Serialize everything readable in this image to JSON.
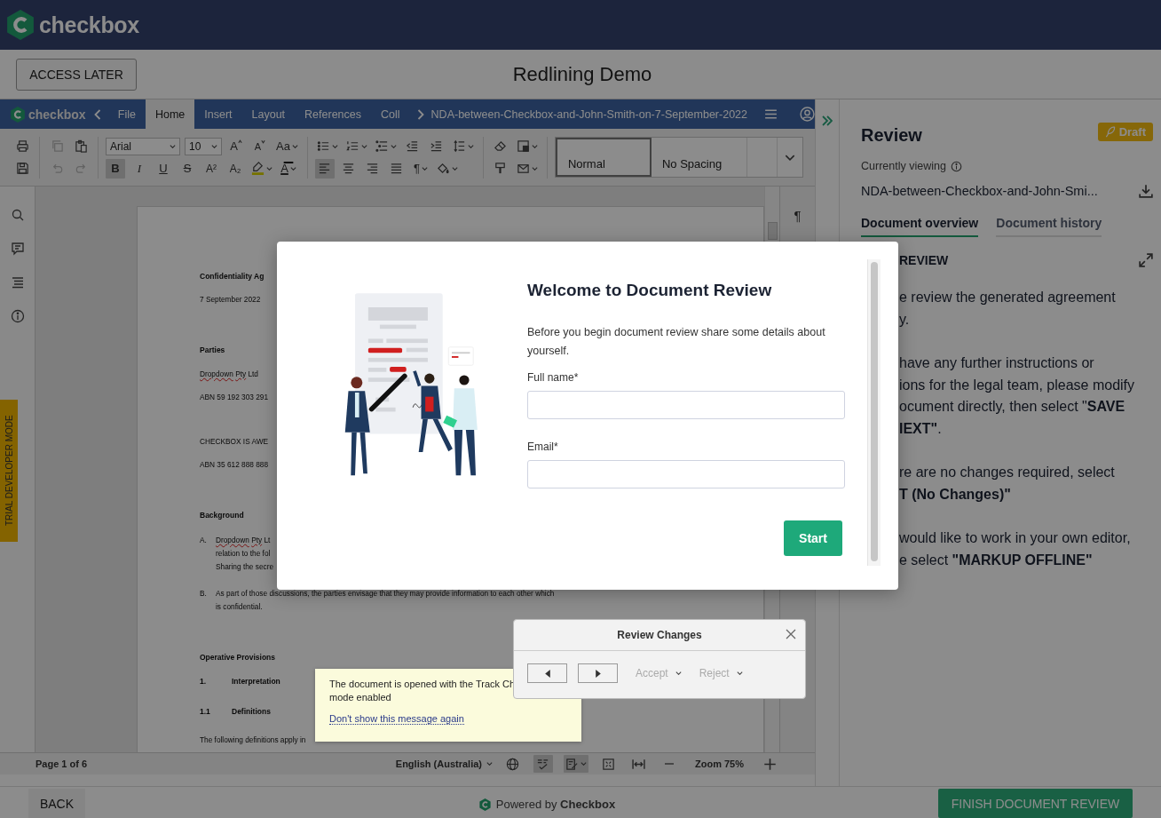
{
  "app_bar": {
    "logo_text": "checkbox"
  },
  "title_bar": {
    "access_later": "ACCESS LATER",
    "title": "Redlining Demo"
  },
  "editor": {
    "menu_bar": {
      "logo_text": "checkbox",
      "tabs": [
        {
          "label": "File",
          "selected": false
        },
        {
          "label": "Home",
          "selected": true
        },
        {
          "label": "Insert",
          "selected": false
        },
        {
          "label": "Layout",
          "selected": false
        },
        {
          "label": "References",
          "selected": false
        },
        {
          "label": "Coll",
          "selected": false
        }
      ],
      "document_name": "NDA-between-Checkbox-and-John-Smith-on-7-September-2022"
    },
    "toolbar": {
      "groups": [
        {
          "top": [
            {
              "kind": "print",
              "active": false,
              "disabled": false,
              "menu": false
            }
          ],
          "bottom": [
            {
              "kind": "save",
              "active": false,
              "disabled": false,
              "menu": false
            }
          ]
        },
        {
          "top": [
            {
              "kind": "copy",
              "active": false,
              "disabled": true,
              "menu": false
            },
            {
              "kind": "paste",
              "active": false,
              "disabled": false,
              "menu": false
            }
          ],
          "bottom": [
            {
              "kind": "undo",
              "active": false,
              "disabled": true,
              "menu": false
            },
            {
              "kind": "redo",
              "active": false,
              "disabled": true,
              "menu": false
            }
          ]
        },
        {
          "top": [
            {
              "kind": "font-select",
              "value": "Arial"
            },
            {
              "kind": "size-select",
              "value": "10"
            },
            {
              "kind": "grow",
              "glyph": "A",
              "active": false,
              "disabled": false,
              "menu": false
            },
            {
              "kind": "shrink",
              "glyph": "A",
              "active": false,
              "disabled": false,
              "menu": false
            },
            {
              "kind": "case",
              "glyph": "Aa",
              "active": false,
              "disabled": false,
              "menu": true
            }
          ],
          "bottom": [
            {
              "kind": "bold",
              "glyph": "B",
              "active": true,
              "disabled": false,
              "menu": false
            },
            {
              "kind": "italic",
              "glyph": "I",
              "active": false,
              "disabled": false,
              "menu": false
            },
            {
              "kind": "underline",
              "glyph": "U",
              "active": false,
              "disabled": false,
              "menu": false
            },
            {
              "kind": "strike",
              "glyph": "S",
              "active": false,
              "disabled": false,
              "menu": false
            },
            {
              "kind": "superscript",
              "glyph": "A²",
              "active": false,
              "disabled": false,
              "menu": false
            },
            {
              "kind": "subscript",
              "glyph": "A₂",
              "active": false,
              "disabled": false,
              "menu": false
            },
            {
              "kind": "highlight",
              "active": false,
              "disabled": false,
              "menu": true
            },
            {
              "kind": "font-color",
              "glyph": "A",
              "active": false,
              "disabled": false,
              "menu": true
            }
          ]
        },
        {
          "top": [
            {
              "kind": "bullets",
              "active": false,
              "disabled": false,
              "menu": true
            },
            {
              "kind": "numbering",
              "active": false,
              "disabled": false,
              "menu": true
            },
            {
              "kind": "multilevel",
              "active": false,
              "disabled": false,
              "menu": true
            },
            {
              "kind": "outdent",
              "active": false,
              "disabled": false,
              "menu": false
            },
            {
              "kind": "indent",
              "active": false,
              "disabled": false,
              "menu": false
            },
            {
              "kind": "line-spacing",
              "active": false,
              "disabled": false,
              "menu": true
            }
          ],
          "bottom": [
            {
              "kind": "align-left",
              "active": true,
              "disabled": false,
              "menu": false
            },
            {
              "kind": "align-center",
              "active": false,
              "disabled": false,
              "menu": false
            },
            {
              "kind": "align-right",
              "active": false,
              "disabled": false,
              "menu": false
            },
            {
              "kind": "justify",
              "active": false,
              "disabled": false,
              "menu": false
            },
            {
              "kind": "pilcrow",
              "glyph": "¶",
              "active": false,
              "disabled": false,
              "menu": true
            },
            {
              "kind": "fill",
              "active": false,
              "disabled": false,
              "menu": true
            }
          ]
        },
        {
          "top": [
            {
              "kind": "eraser",
              "active": false,
              "disabled": false,
              "menu": false
            },
            {
              "kind": "shading",
              "active": false,
              "disabled": false,
              "menu": true
            }
          ],
          "bottom": [
            {
              "kind": "painter",
              "active": false,
              "disabled": false,
              "menu": false
            },
            {
              "kind": "mail",
              "active": false,
              "disabled": false,
              "menu": true
            }
          ]
        }
      ],
      "styles": [
        {
          "label": "Normal",
          "selected": true
        },
        {
          "label": "No Spacing",
          "selected": false
        }
      ]
    },
    "side_tools": [
      {
        "kind": "search"
      },
      {
        "kind": "comments"
      },
      {
        "kind": "navigation"
      },
      {
        "kind": "info"
      }
    ],
    "trial_badge": "TRIAL DEVELOPER MODE",
    "formatting_marks": "¶",
    "document": {
      "blocks": [
        {
          "kind": "title",
          "text": "Confidentiality Ag"
        },
        {
          "kind": "text",
          "text": "7 September 2022"
        },
        {
          "kind": "heading",
          "text": "Parties"
        },
        {
          "kind": "party",
          "words": [
            {
              "text": "Dropdown",
              "misspelled": true
            },
            {
              "text": "Pty",
              "misspelled": true
            },
            {
              "text": "Ltd",
              "misspelled": false
            }
          ]
        },
        {
          "kind": "text",
          "text": "ABN 59 192 303 291"
        },
        {
          "kind": "party",
          "words": [
            {
              "text": "CHECKBOX IS AWE",
              "misspelled": false
            }
          ]
        },
        {
          "kind": "text",
          "text": "ABN 35 612 888 888"
        },
        {
          "kind": "heading",
          "text": "Background"
        },
        {
          "kind": "item",
          "label": "A.",
          "lines": [
            [
              {
                "text": "Dropdown",
                "misspelled": true
              },
              {
                "text": "Pty",
                "misspelled": true
              },
              {
                "text": "Lt",
                "misspelled": false
              }
            ],
            [
              {
                "text": "relation to the fol",
                "misspelled": false
              }
            ],
            [
              {
                "text": "Sharing the secre",
                "misspelled": false
              }
            ]
          ]
        },
        {
          "kind": "item",
          "label": "B.",
          "lines": [
            [
              {
                "text": "As part of those discussions, the parties envisage that they may provide information to each other which",
                "misspelled": false
              }
            ],
            [
              {
                "text": "is confidential.",
                "misspelled": false
              }
            ]
          ]
        },
        {
          "kind": "heading",
          "text": "Operative Provisions"
        },
        {
          "kind": "numbered",
          "label": "1.",
          "text": "Interpretation"
        },
        {
          "kind": "numbered",
          "label": "1.1",
          "text": "Definitions"
        },
        {
          "kind": "text",
          "text": "The following definitions apply in"
        }
      ]
    },
    "status_bar": {
      "page": "Page 1 of 6",
      "language": "English (Australia)",
      "tools": [
        {
          "kind": "globe",
          "active": false,
          "disabled": false,
          "menu": false
        },
        {
          "kind": "spellcheck",
          "active": true,
          "disabled": false,
          "menu": false
        },
        {
          "kind": "track-changes",
          "active": true,
          "disabled": false,
          "menu": true
        },
        {
          "kind": "fit-page",
          "active": false,
          "disabled": false,
          "menu": false
        },
        {
          "kind": "fit-width",
          "active": false,
          "disabled": false,
          "menu": false
        },
        {
          "kind": "zoom-out",
          "active": false,
          "disabled": false,
          "menu": false
        }
      ],
      "zoom": "Zoom 75%",
      "zoom_in": {
        "kind": "zoom-in",
        "active": false,
        "disabled": false,
        "menu": false
      }
    },
    "track_changes_tip": {
      "lines": [
        "The document is opened with the Track Ch",
        "mode enabled"
      ],
      "link": "Don't show this message again"
    },
    "review_changes": {
      "title": "Review Changes",
      "actions": [
        {
          "label": "Accept",
          "disabled": true
        },
        {
          "label": "Reject",
          "disabled": true
        }
      ]
    }
  },
  "review_panel": {
    "title": "Review",
    "status": "Draft",
    "viewing_label": "Currently viewing",
    "file_name": "NDA-between-Checkbox-and-John-Smi...",
    "tabs": [
      {
        "label": "Document overview",
        "selected": true
      },
      {
        "label": "Document history",
        "selected": false
      }
    ],
    "section_title": "REVIEW",
    "paragraphs": [
      [
        "e review the generated agreement",
        "y."
      ],
      [
        "have any further instructions or",
        "ions for the legal team, please modify",
        "ocument directly, then select \"**SAVE**",
        "**IEXT\"**."
      ],
      [
        "re are no changes required, select",
        "**T (No Changes)\"**"
      ],
      [
        "would like to work in your own editor,",
        "e select **\"MARKUP OFFLINE\"**"
      ]
    ]
  },
  "welcome_dialog": {
    "title": "Welcome to Document Review",
    "description": "Before you begin document review share some details about yourself.",
    "fields": [
      {
        "label": "Full name*"
      },
      {
        "label": "Email*"
      }
    ],
    "submit": "Start"
  },
  "footer": {
    "back": "BACK",
    "powered_by": "Powered by **Checkbox**",
    "finish": "FINISH DOCUMENT REVIEW"
  }
}
